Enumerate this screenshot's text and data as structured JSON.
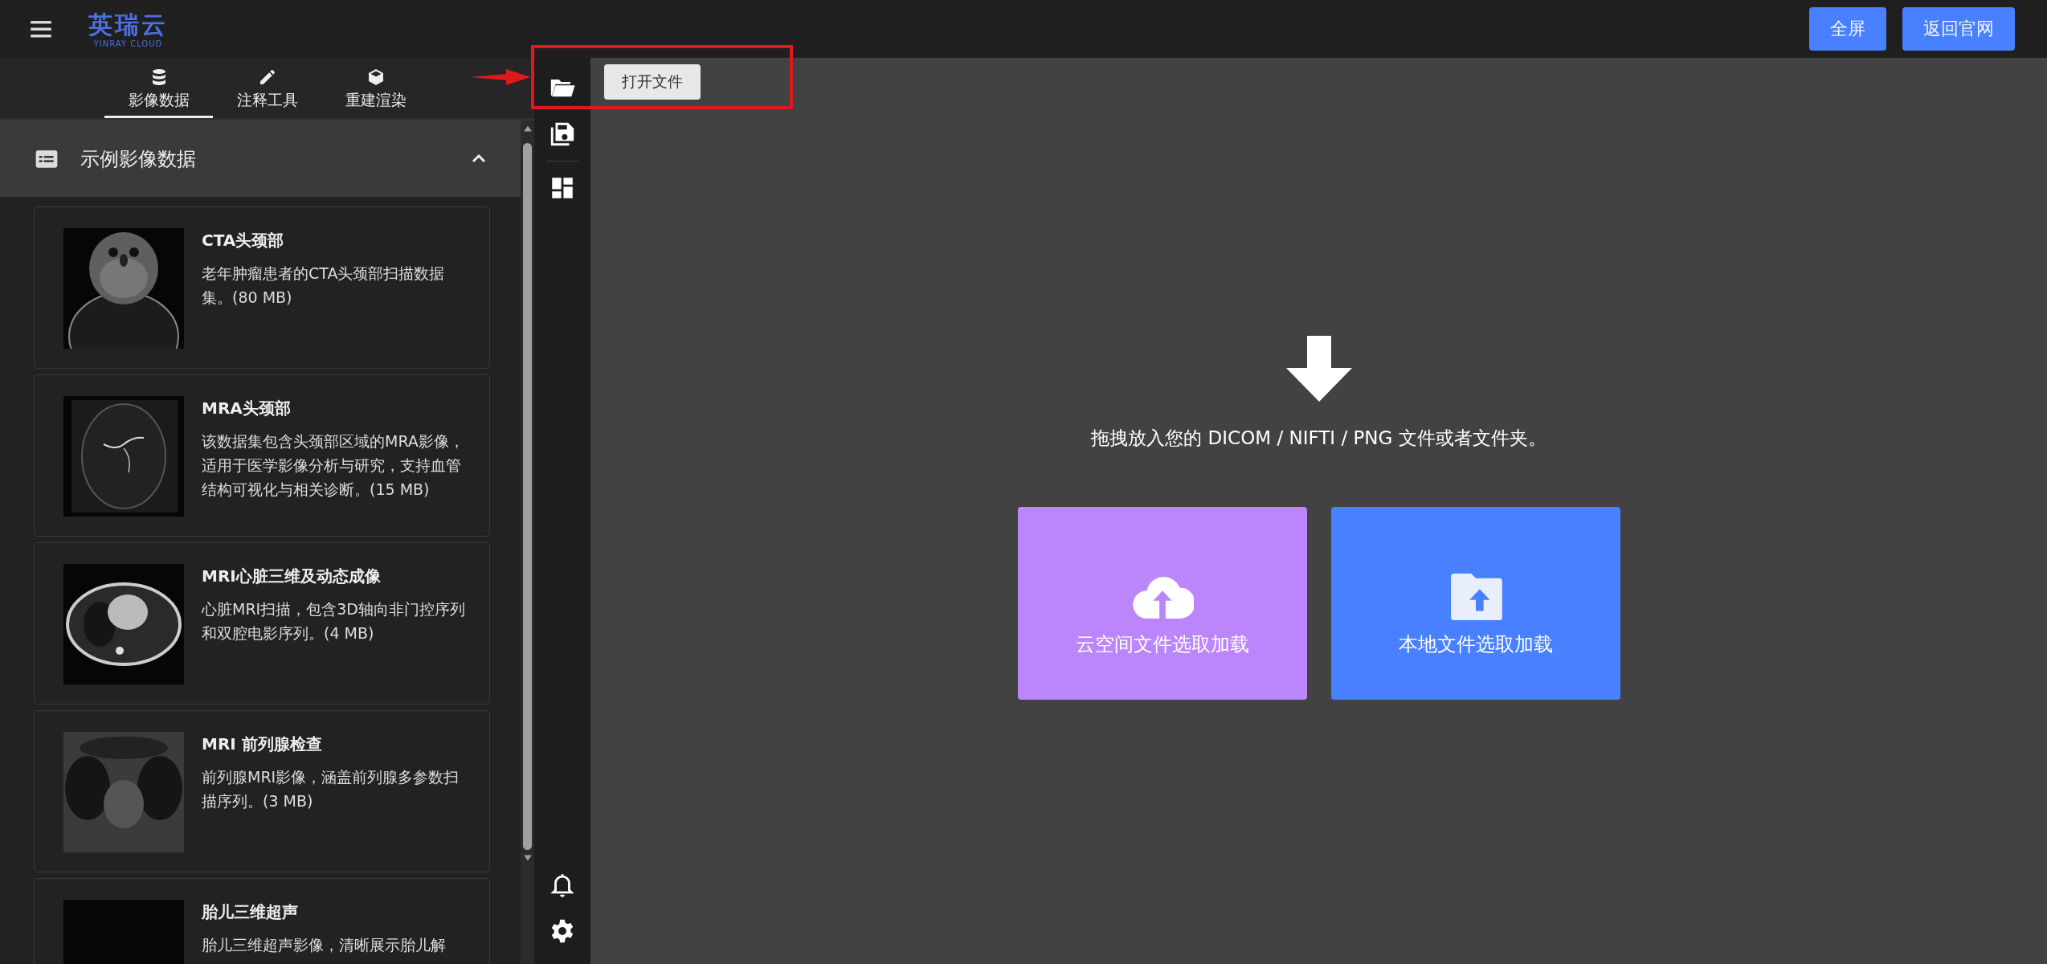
{
  "header": {
    "logo_text": "英瑞云",
    "logo_subtitle": "YINRAY CLOUD",
    "buttons": [
      "全屏",
      "返回官网"
    ]
  },
  "tabs": [
    {
      "label": "影像数据",
      "kind": "database",
      "selected": true
    },
    {
      "label": "注释工具",
      "kind": "pencil",
      "selected": false
    },
    {
      "label": "重建渲染",
      "kind": "cube",
      "selected": false
    }
  ],
  "accordion": {
    "title": "示例影像数据",
    "expanded": true
  },
  "datasets": [
    {
      "title": "CTA头颈部",
      "description": "老年肿瘤患者的CTA头颈部扫描数据集。(80 MB)"
    },
    {
      "title": "MRA头颈部",
      "description": "该数据集包含头颈部区域的MRA影像，适用于医学影像分析与研究，支持血管结构可视化与相关诊断。(15 MB)"
    },
    {
      "title": "MRI心脏三维及动态成像",
      "description": "心脏MRI扫描，包含3D轴向非门控序列和双腔电影序列。(4 MB)"
    },
    {
      "title": "MRI 前列腺检查",
      "description": "前列腺MRI影像，涵盖前列腺多参数扫描序列。(3 MB)"
    },
    {
      "title": "胎儿三维超声",
      "description": "胎儿三维超声影像，清晰展示胎儿解"
    }
  ],
  "toolbar": {
    "tooltip": "打开文件"
  },
  "drop_zone": {
    "message": "拖拽放入您的 DICOM / NIFTI / PNG 文件或者文件夹。",
    "buttons": [
      {
        "label": "云空间文件选取加载",
        "kind": "cloud",
        "color": "#bb86fc"
      },
      {
        "label": "本地文件选取加载",
        "kind": "local",
        "color": "#4880ff"
      }
    ]
  }
}
